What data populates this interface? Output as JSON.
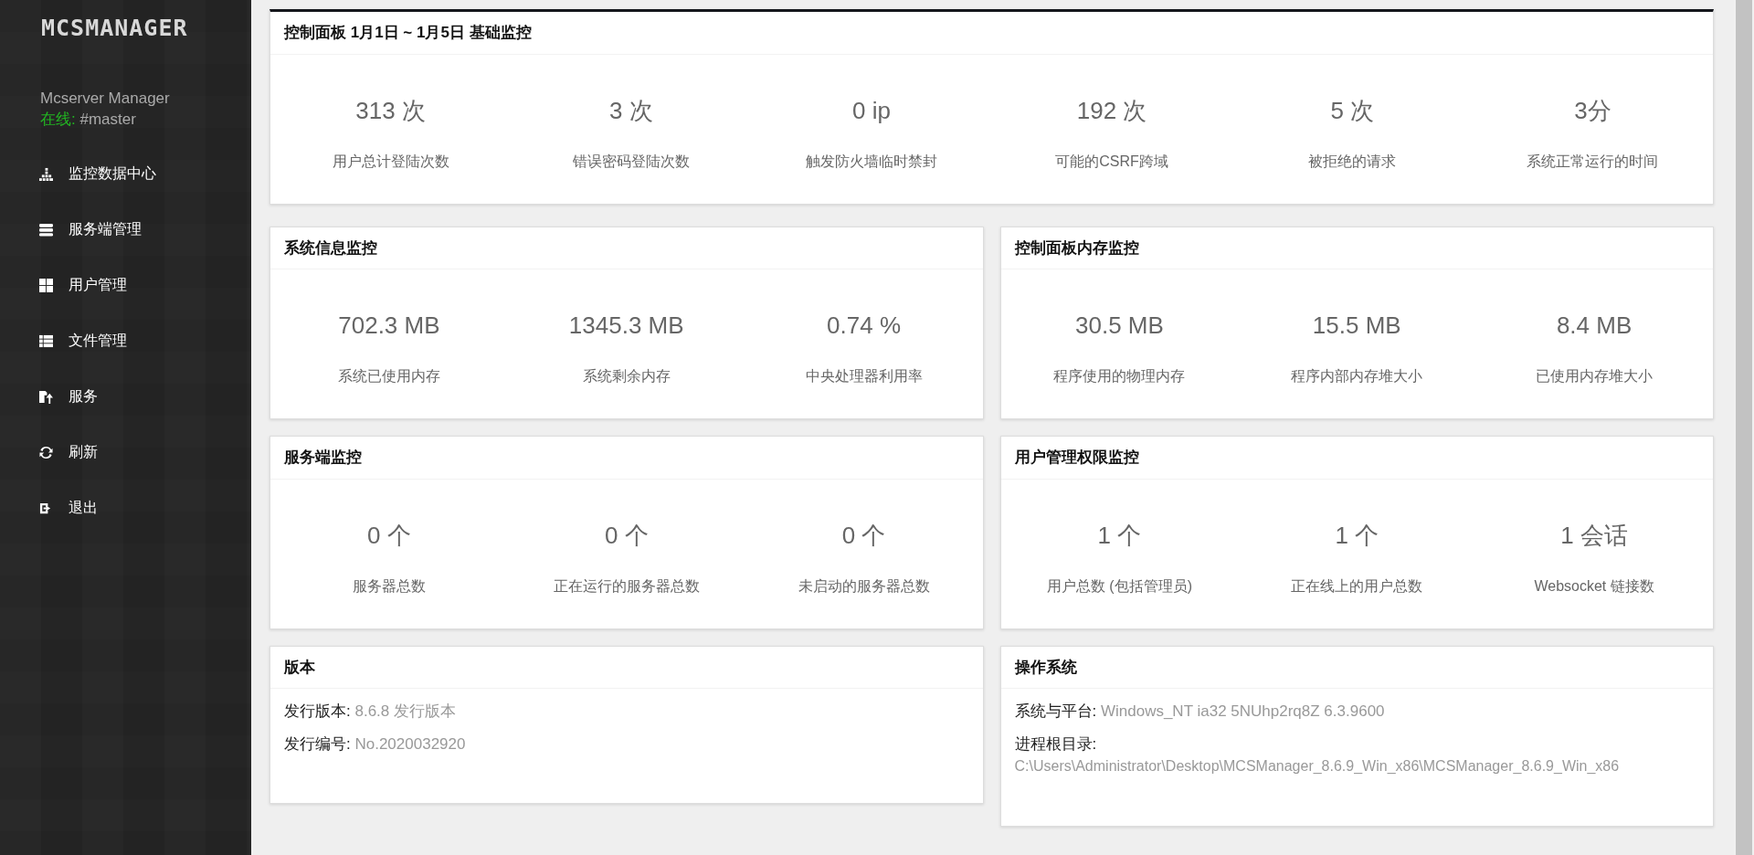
{
  "sidebar": {
    "logo": "MCSMANAGER",
    "app_name": "Mcserver Manager",
    "status_label": "在线:",
    "user": "#master",
    "items": [
      {
        "label": "监控数据中心",
        "kind": "bars"
      },
      {
        "label": "服务端管理",
        "kind": "servers"
      },
      {
        "label": "用户管理",
        "kind": "grid"
      },
      {
        "label": "文件管理",
        "kind": "list"
      },
      {
        "label": "服务",
        "kind": "upload"
      },
      {
        "label": "刷新",
        "kind": "refresh"
      },
      {
        "label": "退出",
        "kind": "exit"
      }
    ]
  },
  "overview": {
    "title": "控制面板 1月1日 ~ 1月5日 基础监控",
    "stats": [
      {
        "value": "313 次",
        "label": "用户总计登陆次数"
      },
      {
        "value": "3 次",
        "label": "错误密码登陆次数"
      },
      {
        "value": "0 ip",
        "label": "触发防火墙临时禁封"
      },
      {
        "value": "192 次",
        "label": "可能的CSRF跨域"
      },
      {
        "value": "5 次",
        "label": "被拒绝的请求"
      },
      {
        "value": "3分",
        "label": "系统正常运行的时间"
      }
    ]
  },
  "panels": [
    {
      "title": "系统信息监控",
      "stats": [
        {
          "value": "702.3 MB",
          "label": "系统已使用内存"
        },
        {
          "value": "1345.3 MB",
          "label": "系统剩余内存"
        },
        {
          "value": "0.74 %",
          "label": "中央处理器利用率"
        }
      ]
    },
    {
      "title": "控制面板内存监控",
      "stats": [
        {
          "value": "30.5 MB",
          "label": "程序使用的物理内存"
        },
        {
          "value": "15.5 MB",
          "label": "程序内部内存堆大小"
        },
        {
          "value": "8.4 MB",
          "label": "已使用内存堆大小"
        }
      ]
    },
    {
      "title": "服务端监控",
      "stats": [
        {
          "value": "0 个",
          "label": "服务器总数"
        },
        {
          "value": "0 个",
          "label": "正在运行的服务器总数"
        },
        {
          "value": "0 个",
          "label": "未启动的服务器总数"
        }
      ]
    },
    {
      "title": "用户管理权限监控",
      "stats": [
        {
          "value": "1 个",
          "label": "用户总数 (包括管理员)"
        },
        {
          "value": "1 个",
          "label": "正在线上的用户总数"
        },
        {
          "value": "1 会话",
          "label": "Websocket 链接数"
        }
      ]
    }
  ],
  "info_panels": [
    {
      "title": "版本",
      "lines": [
        {
          "kind": "inline",
          "label": "发行版本:",
          "value": "8.6.8 发行版本"
        },
        {
          "kind": "inline",
          "label": "发行编号:",
          "value": "No.2020032920"
        }
      ]
    },
    {
      "title": "操作系统",
      "lines": [
        {
          "kind": "inline",
          "label": "系统与平台:",
          "value": "Windows_NT ia32 5NUhp2rq8Z 6.3.9600"
        },
        {
          "kind": "stacked",
          "label": "进程根目录:",
          "value": "C:\\Users\\Administrator\\Desktop\\MCSManager_8.6.9_Win_x86\\MCSManager_8.6.9_Win_x86"
        }
      ]
    }
  ]
}
